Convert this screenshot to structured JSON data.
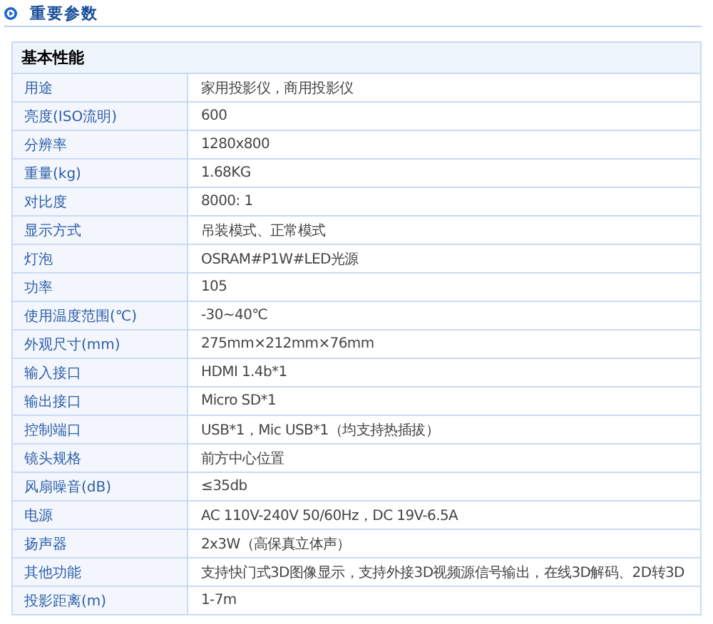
{
  "section": {
    "title": "重要参数"
  },
  "table": {
    "title": "基本性能",
    "rows": [
      {
        "label": "用途",
        "value": "家用投影仪，商用投影仪"
      },
      {
        "label": "亮度(ISO流明)",
        "value": "600"
      },
      {
        "label": "分辨率",
        "value": "1280x800"
      },
      {
        "label": "重量(kg)",
        "value": "1.68KG"
      },
      {
        "label": "对比度",
        "value": "8000: 1"
      },
      {
        "label": "显示方式",
        "value": "吊装模式、正常模式"
      },
      {
        "label": "灯泡",
        "value": "OSRAM#P1W#LED光源"
      },
      {
        "label": "功率",
        "value": "105"
      },
      {
        "label": "使用温度范围(℃)",
        "value": "-30~40℃"
      },
      {
        "label": "外观尺寸(mm)",
        "value": "275mm×212mm×76mm"
      },
      {
        "label": "输入接口",
        "value": "HDMI 1.4b*1"
      },
      {
        "label": "输出接口",
        "value": "Micro SD*1"
      },
      {
        "label": "控制端口",
        "value": "USB*1，Mic USB*1（均支持热插拔）"
      },
      {
        "label": "镜头规格",
        "value": "前方中心位置"
      },
      {
        "label": "风扇噪音(dB)",
        "value": "≤35db"
      },
      {
        "label": "电源",
        "value": "AC 110V-240V 50/60Hz，DC 19V-6.5A"
      },
      {
        "label": "扬声器",
        "value": "2x3W（高保真立体声）"
      },
      {
        "label": "其他功能",
        "value": "支持快门式3D图像显示，支持外接3D视频源信号输出，在线3D解码、2D转3D"
      },
      {
        "label": "投影距离(m)",
        "value": "1-7m"
      }
    ]
  }
}
